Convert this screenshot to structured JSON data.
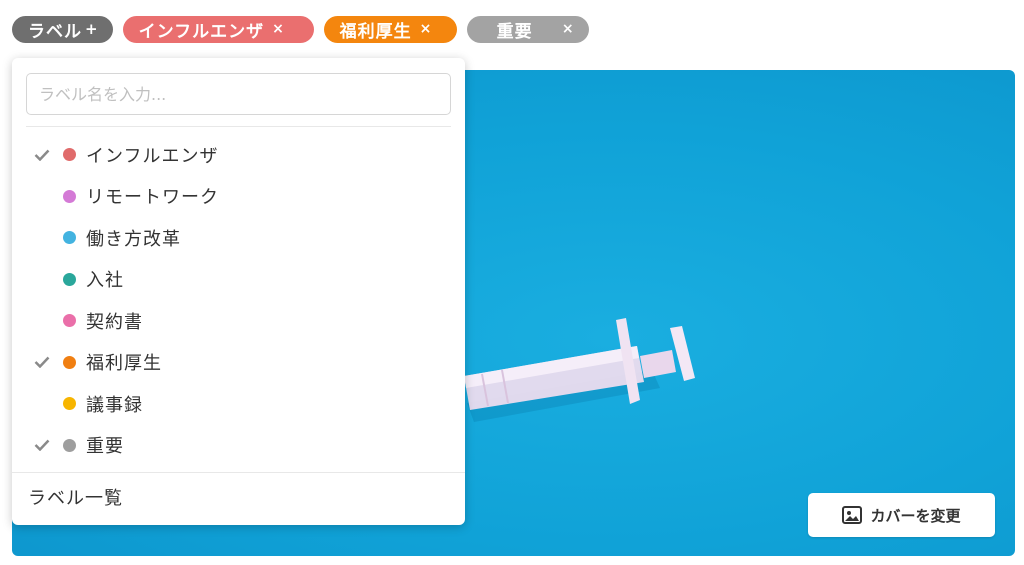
{
  "chips": {
    "add_label": "ラベル",
    "add_plus": "+",
    "remove_glyph": "×",
    "selected": [
      {
        "label": "インフルエンザ",
        "color": "#ea6f6f"
      },
      {
        "label": "福利厚生",
        "color": "#f4860e"
      },
      {
        "label": "重要",
        "color": "#a3a3a3"
      }
    ]
  },
  "dropdown": {
    "search_placeholder": "ラベル名を入力...",
    "search_value": "",
    "items": [
      {
        "label": "インフルエンザ",
        "color": "#e06b6b",
        "checked": true
      },
      {
        "label": "リモートワーク",
        "color": "#d47ad6",
        "checked": false
      },
      {
        "label": "働き方改革",
        "color": "#43b3e0",
        "checked": false
      },
      {
        "label": "入社",
        "color": "#2aa79b",
        "checked": false
      },
      {
        "label": "契約書",
        "color": "#ea6fa9",
        "checked": false
      },
      {
        "label": "福利厚生",
        "color": "#f07f12",
        "checked": true
      },
      {
        "label": "議事録",
        "color": "#f7b500",
        "checked": false
      },
      {
        "label": "重要",
        "color": "#9e9e9e",
        "checked": true
      }
    ],
    "footer_link": "ラベル一覧"
  },
  "cover": {
    "change_button_label": "カバーを変更",
    "button_icon": "image-icon",
    "background_color": "#10a2d7"
  }
}
